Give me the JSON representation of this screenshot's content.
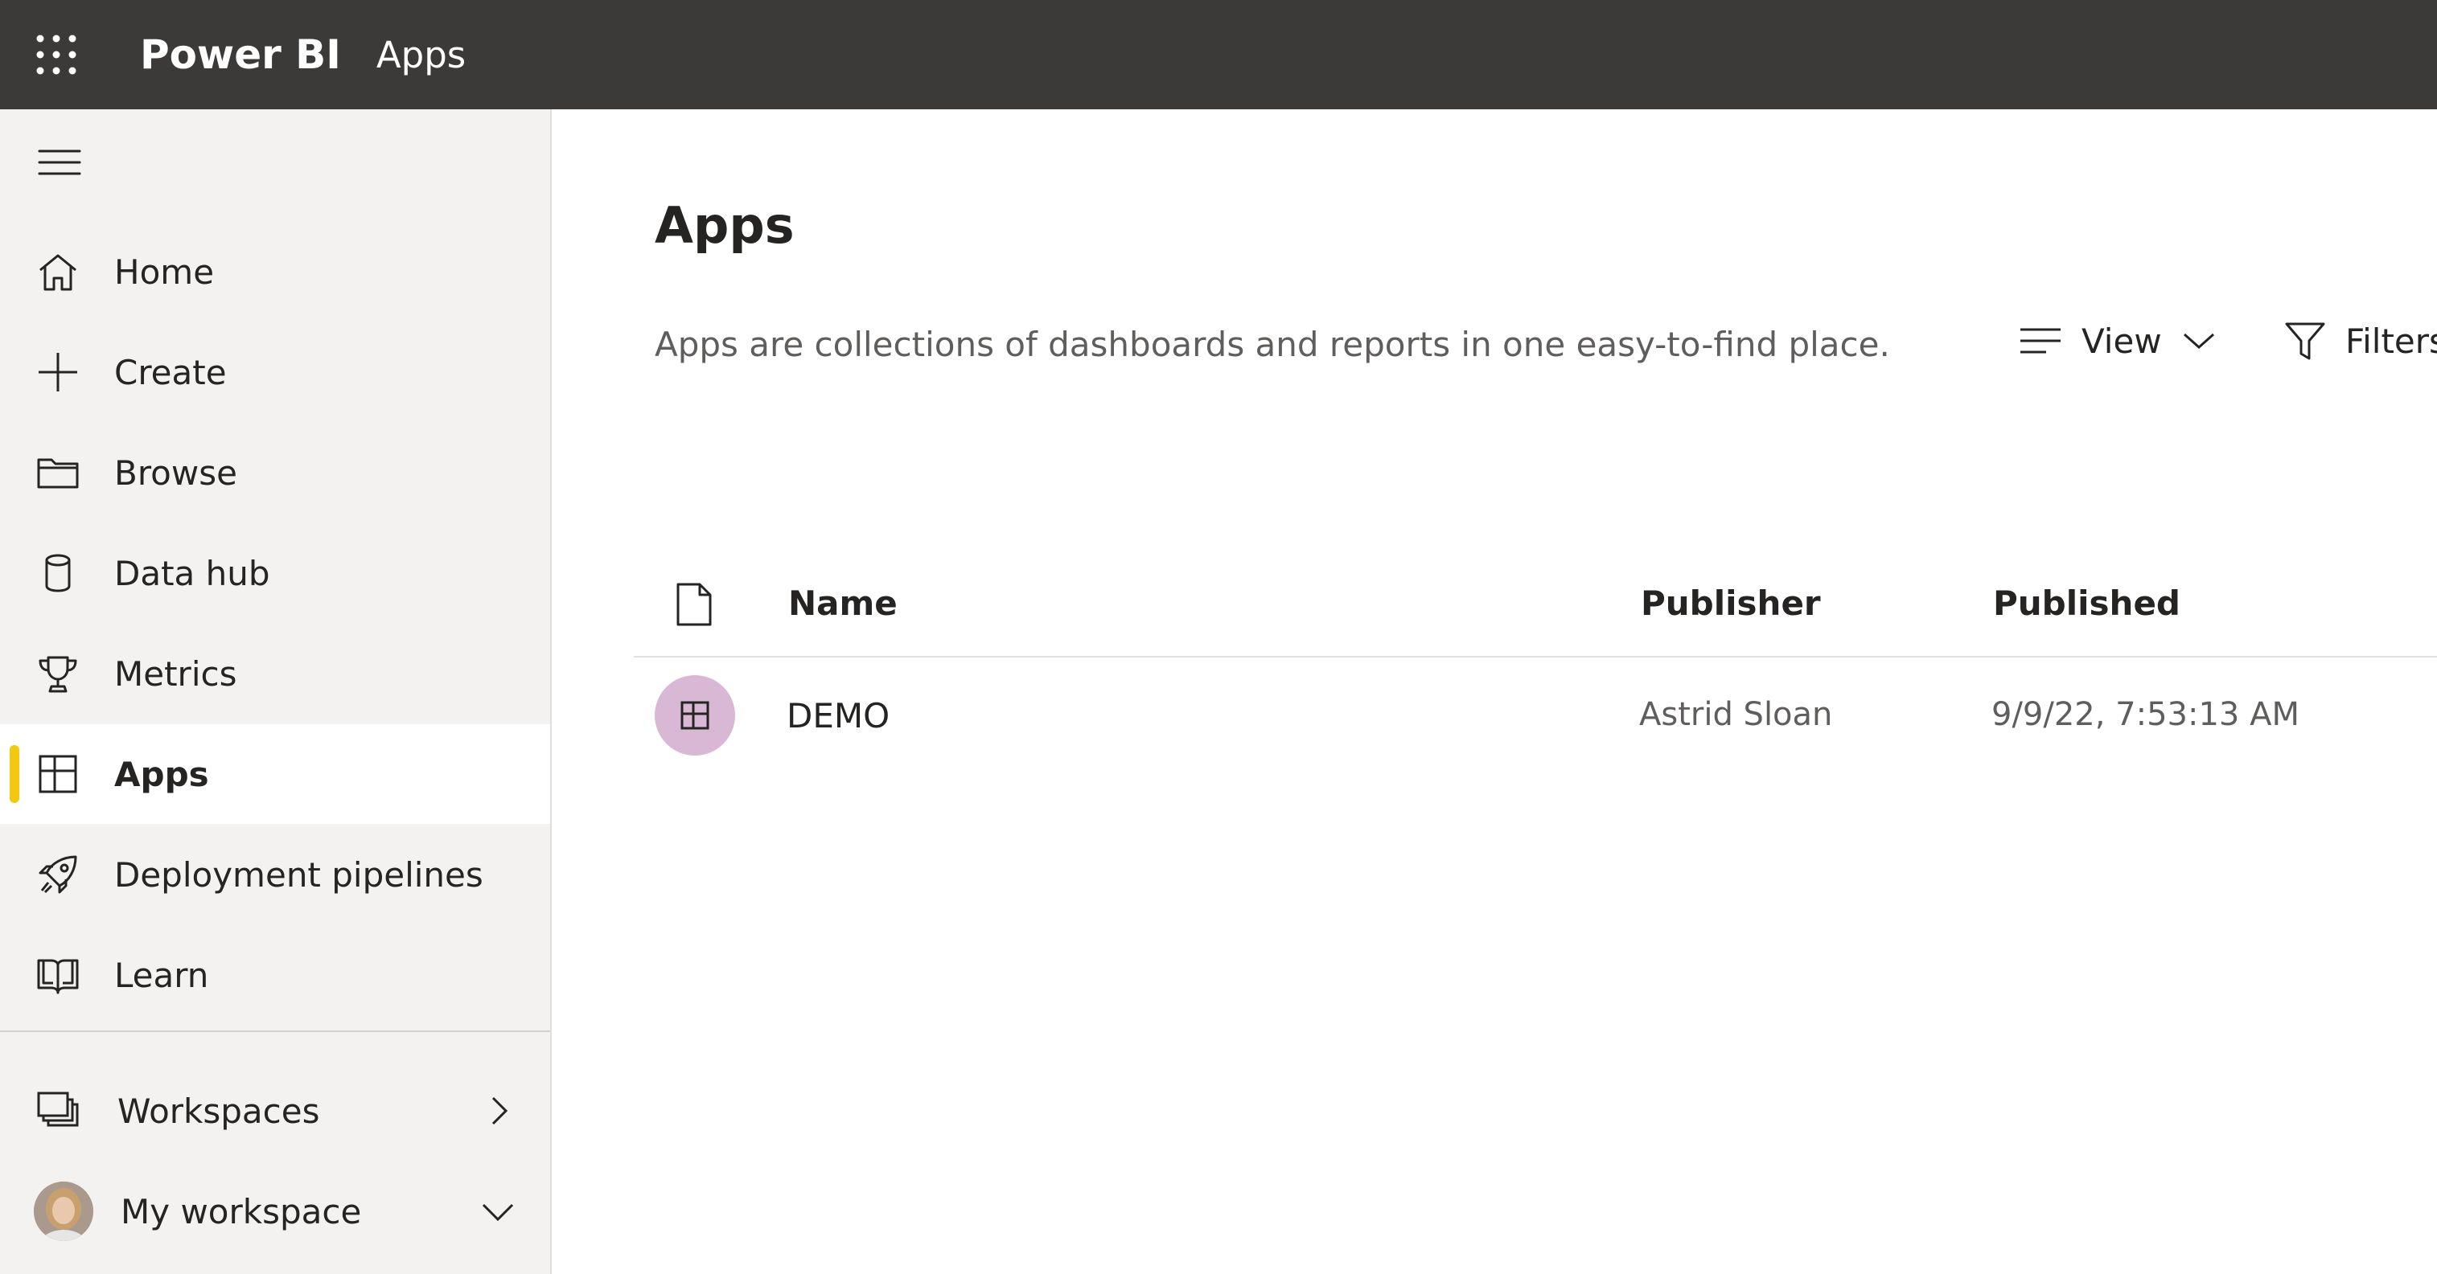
{
  "topbar": {
    "brand": "Power BI",
    "breadcrumb": "Apps"
  },
  "sidebar": {
    "items": [
      {
        "label": "Home",
        "icon": "home-icon"
      },
      {
        "label": "Create",
        "icon": "plus-icon"
      },
      {
        "label": "Browse",
        "icon": "folder-icon"
      },
      {
        "label": "Data hub",
        "icon": "database-icon"
      },
      {
        "label": "Metrics",
        "icon": "trophy-icon"
      },
      {
        "label": "Apps",
        "icon": "apps-icon",
        "active": true
      },
      {
        "label": "Deployment pipelines",
        "icon": "rocket-icon"
      },
      {
        "label": "Learn",
        "icon": "book-icon"
      }
    ],
    "workspaces_label": "Workspaces",
    "my_workspace_label": "My workspace"
  },
  "main": {
    "title": "Apps",
    "description": "Apps are collections of dashboards and reports in one easy-to-find place.",
    "toolbar": {
      "view_label": "View",
      "filters_label": "Filters"
    },
    "table": {
      "columns": [
        "Name",
        "Publisher",
        "Published"
      ],
      "rows": [
        {
          "name": "DEMO",
          "publisher": "Astrid Sloan",
          "published": "9/9/22, 7:53:13 AM"
        }
      ]
    }
  },
  "colors": {
    "topbar": "#3b3a39",
    "sidebar": "#f3f2f1",
    "active_indicator": "#f2c811",
    "app_badge": "#d8b8d4"
  }
}
